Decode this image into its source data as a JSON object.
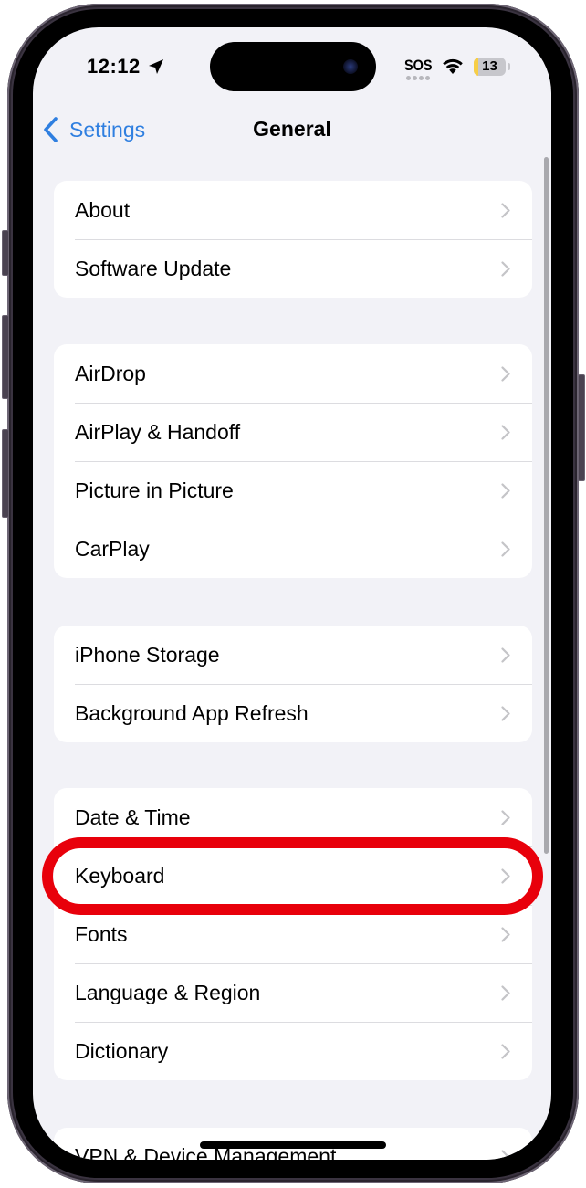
{
  "status_bar": {
    "time": "12:12",
    "location_icon": "location-arrow-icon",
    "carrier_status": "SOS",
    "wifi_icon": "wifi-icon",
    "battery_level": "13",
    "battery_fraction": 0.13,
    "battery_color": "#f7ce46"
  },
  "nav": {
    "back_label": "Settings",
    "title": "General",
    "accent_color": "#2f7fe0"
  },
  "groups": [
    {
      "items": [
        {
          "label": "About"
        },
        {
          "label": "Software Update"
        }
      ]
    },
    {
      "items": [
        {
          "label": "AirDrop"
        },
        {
          "label": "AirPlay & Handoff"
        },
        {
          "label": "Picture in Picture"
        },
        {
          "label": "CarPlay"
        }
      ]
    },
    {
      "items": [
        {
          "label": "iPhone Storage"
        },
        {
          "label": "Background App Refresh"
        }
      ]
    },
    {
      "items": [
        {
          "label": "Date & Time"
        },
        {
          "label": "Keyboard"
        },
        {
          "label": "Fonts"
        },
        {
          "label": "Language & Region"
        },
        {
          "label": "Dictionary"
        }
      ]
    },
    {
      "items": [
        {
          "label": "VPN & Device Management"
        }
      ]
    }
  ],
  "annotation": {
    "highlighted_item": "Keyboard",
    "color": "#e8000b"
  }
}
